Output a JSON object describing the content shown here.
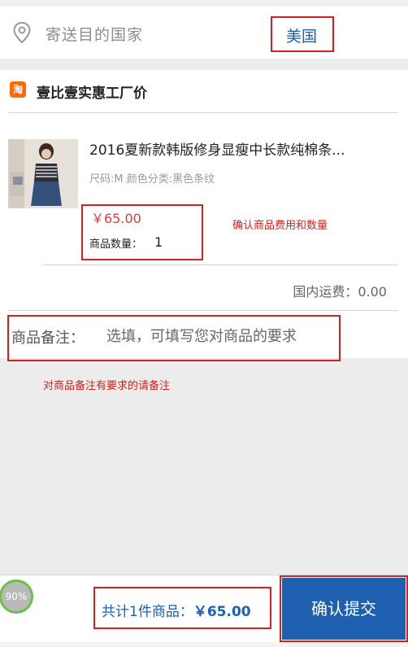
{
  "destination": {
    "label": "寄送目的国家",
    "country": "美国"
  },
  "shop": {
    "icon_text": "淘",
    "name": "壹比壹实惠工厂价"
  },
  "product": {
    "title": "2016夏新款韩版修身显瘦中长款纯棉条...",
    "spec": "尺码:M 颜色分类:黑色条纹",
    "price": "￥65.00",
    "qty_label": "商品数量：",
    "qty_value": "1"
  },
  "annotations": {
    "confirm_fee": "确认商品费用和数量",
    "remark_hint": "对商品备注有要求的请备注"
  },
  "shipping": "国内运费：0.00",
  "remark": {
    "label": "商品备注：",
    "placeholder": "选填，可填写您对商品的要求"
  },
  "footer": {
    "progress": "90%",
    "total_prefix": "共计1件商品：",
    "total_amount": "￥65.00",
    "submit_label": "确认提交"
  },
  "colors": {
    "accent_blue": "#1f5fb0",
    "annotation_red": "#d22222",
    "price_red": "#e03a3a",
    "shop_orange": "#ff6a00"
  }
}
